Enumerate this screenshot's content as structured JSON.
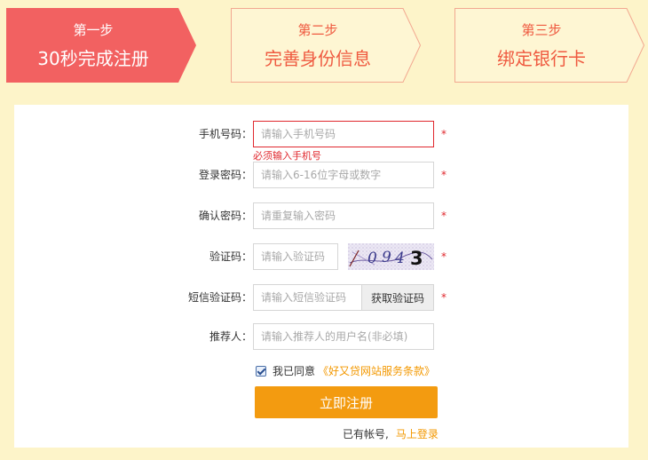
{
  "steps": [
    {
      "num": "第一步",
      "title": "30秒完成注册",
      "active": true
    },
    {
      "num": "第二步",
      "title": "完善身份信息",
      "active": false
    },
    {
      "num": "第三步",
      "title": "绑定银行卡",
      "active": false
    }
  ],
  "colors": {
    "page_bg": "#fdf4c9",
    "step_active_fill": "#f26161",
    "step_inactive_fill": "#fef6d3",
    "step_inactive_border": "#f2a890",
    "accent_orange": "#f39b10",
    "error_red": "#e0282e"
  },
  "form": {
    "phone": {
      "label": "手机号码：",
      "placeholder": "请输入手机号码",
      "value": "",
      "error": "必须输入手机号",
      "required": "*"
    },
    "password": {
      "label": "登录密码：",
      "placeholder": "请输入6-16位字母或数字",
      "value": "",
      "required": "*"
    },
    "confirm": {
      "label": "确认密码：",
      "placeholder": "请重复输入密码",
      "value": "",
      "required": "*"
    },
    "captcha": {
      "label": "验证码：",
      "placeholder": "请输入验证码",
      "value": "",
      "image_text": "0943",
      "required": "*"
    },
    "sms": {
      "label": "短信验证码：",
      "placeholder": "请输入短信验证码",
      "value": "",
      "button": "获取验证码",
      "required": "*"
    },
    "referrer": {
      "label": "推荐人：",
      "placeholder": "请输入推荐人的用户名(非必填)",
      "value": ""
    }
  },
  "agreement": {
    "checked": true,
    "text": "我已同意",
    "link": "《好又贷网站服务条款》"
  },
  "submit_label": "立即注册",
  "login": {
    "text": "已有帐号,",
    "link": "马上登录"
  }
}
